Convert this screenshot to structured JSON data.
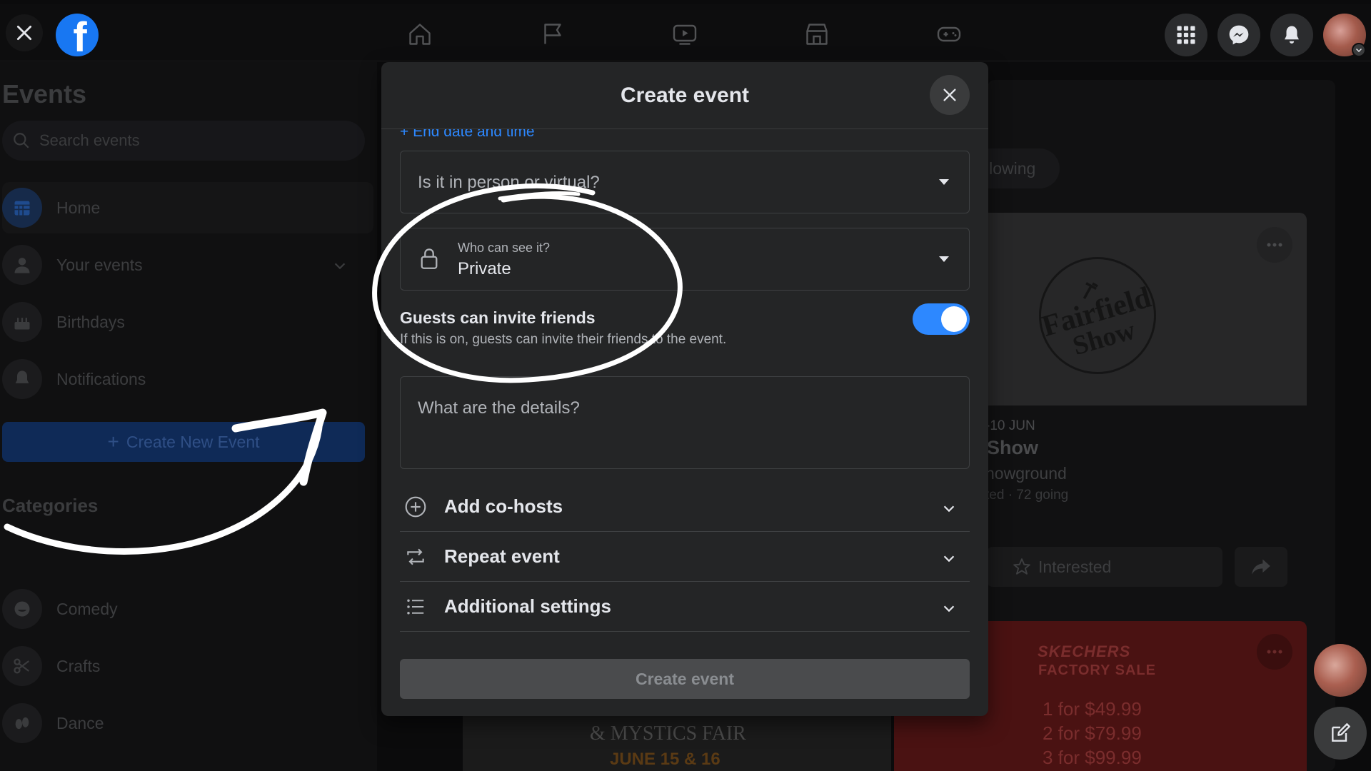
{
  "topbar": {
    "icons": [
      "close-icon",
      "facebook-logo",
      "home-icon",
      "flag-icon",
      "video-icon",
      "marketplace-icon",
      "gaming-icon",
      "menu-grid-icon",
      "messenger-icon",
      "bell-icon",
      "avatar"
    ]
  },
  "sidebar": {
    "title": "Events",
    "search_placeholder": "Search events",
    "items": [
      {
        "label": "Home",
        "icon": "calendar-icon"
      },
      {
        "label": "Your events",
        "icon": "person-icon"
      },
      {
        "label": "Birthdays",
        "icon": "cake-icon"
      },
      {
        "label": "Notifications",
        "icon": "bell-icon"
      }
    ],
    "create_new": "Create New Event",
    "categories_title": "Categories",
    "categories": [
      {
        "label": "Comedy",
        "icon": "laugh-icon"
      },
      {
        "label": "Crafts",
        "icon": "scissors-icon"
      },
      {
        "label": "Dance",
        "icon": "dance-icon"
      }
    ]
  },
  "feed": {
    "chip": "llowing",
    "seal_line1": "Fairfield",
    "seal_line2": "Show",
    "date": "-10 JUN",
    "name": "Show",
    "location": "howground",
    "meta": "ted · 72 going",
    "interested": "Interested",
    "promo_brand": "SKECHERS",
    "promo_sub": "FACTORY SALE",
    "promo_lines": [
      "1 for $49.99",
      "2 for $79.99",
      "3 for $99.99"
    ],
    "fair_text": "& MYSTICS FAIR",
    "fair_date": "JUNE 15 & 16"
  },
  "modal": {
    "title": "Create event",
    "end_date_link": "+ End date and time",
    "location_type_placeholder": "Is it in person or virtual?",
    "privacy_label": "Who can see it?",
    "privacy_value": "Private",
    "guests_invite_title": "Guests can invite friends",
    "guests_invite_desc": "If this is on, guests can invite their friends to the event.",
    "guests_invite_on": true,
    "details_placeholder": "What are the details?",
    "accordion": [
      {
        "label": "Add co-hosts",
        "icon": "plus-circle-icon"
      },
      {
        "label": "Repeat event",
        "icon": "repeat-icon"
      },
      {
        "label": "Additional settings",
        "icon": "list-icon"
      }
    ],
    "submit_label": "Create event"
  },
  "colors": {
    "accent": "#2d88ff",
    "modal_bg": "#242526",
    "page_bg": "#0b0b0c",
    "annotation": "#ffffff"
  }
}
